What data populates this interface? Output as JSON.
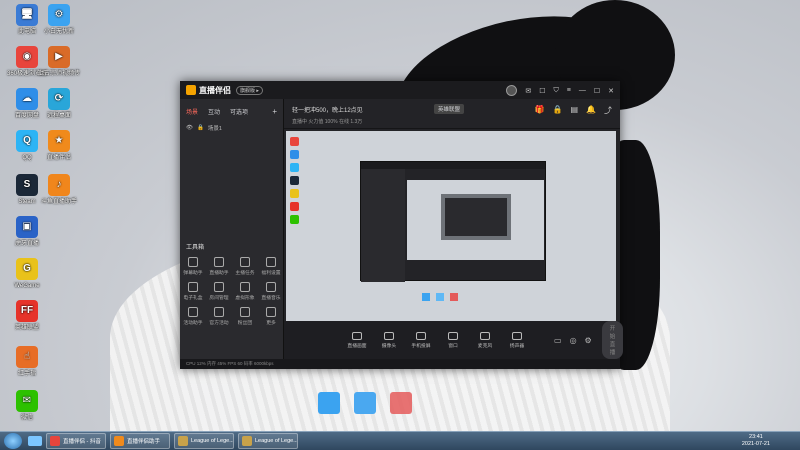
{
  "desktop_icons": [
    {
      "label": "此电脑",
      "color": "#3a7bd5",
      "glyph": "🖥"
    },
    {
      "label": "小白无忧新",
      "color": "#3ba3f0",
      "glyph": "⚙"
    },
    {
      "label": "360极速浏览器",
      "color": "#e8453c",
      "glyph": "◉"
    },
    {
      "label": "上古宗师视频传",
      "color": "#d96b28",
      "glyph": "▶"
    },
    {
      "label": "百度网盘",
      "color": "#2f8ee8",
      "glyph": "☁"
    },
    {
      "label": "远程桌面",
      "color": "#29a6d9",
      "glyph": "⟳"
    },
    {
      "label": "QQ",
      "color": "#2db4f5",
      "glyph": "Q"
    },
    {
      "label": "直播伴侣",
      "color": "#f08a1c",
      "glyph": "★"
    },
    {
      "label": "Steam",
      "color": "#1b2838",
      "glyph": "S"
    },
    {
      "label": "斗鱼直播助手",
      "color": "#f0861c",
      "glyph": "♪"
    },
    {
      "label": "虎牙直播",
      "color": "#2a63c7",
      "glyph": "▣"
    },
    {
      "label": "WeGame",
      "color": "#e9c21a",
      "glyph": "G"
    },
    {
      "label": "英雄联盟",
      "color": "#e6332a",
      "glyph": "FF"
    },
    {
      "label": "红手指",
      "color": "#e76d26",
      "glyph": "☝"
    },
    {
      "label": "微信",
      "color": "#2dc100",
      "glyph": "✉"
    }
  ],
  "window": {
    "app_name": "直播伴侣",
    "version": "旗舰版 ▸",
    "info_title": "轻一把冲500，晚上12点见",
    "category": "英雄联盟",
    "stats": "直播中  火力值 100%  在线 1.3万",
    "sidebar_tabs": [
      "场景",
      "互动",
      "可选项"
    ],
    "scene_label": "场景1",
    "tools_title": "工具箱",
    "tools": [
      "弹幕助手",
      "直播助手",
      "主播任务",
      "福利设置",
      "电子礼盒",
      "房间管理",
      "虚拟形象",
      "直播音乐",
      "活动助手",
      "官方活动",
      "粉丝团",
      "更多"
    ],
    "bottom_buttons": [
      "直播画面",
      "摄像头",
      "手机投屏",
      "窗口",
      "麦克风",
      "扬声器"
    ],
    "start_button": "开始直播",
    "status_text": "CPU 12%   内存 45%   FPS 60   码率 6000kbps"
  },
  "taskbar": {
    "buttons": [
      {
        "label": "直播伴侣 - 抖音",
        "color": "#e8453c"
      },
      {
        "label": "直播伴侣助手",
        "color": "#f08a1c"
      },
      {
        "label": "League of Lege...",
        "color": "#c8a24a"
      },
      {
        "label": "League of Lege...",
        "color": "#c8a24a"
      }
    ],
    "time": "23:41",
    "date": "2021-07-21"
  }
}
